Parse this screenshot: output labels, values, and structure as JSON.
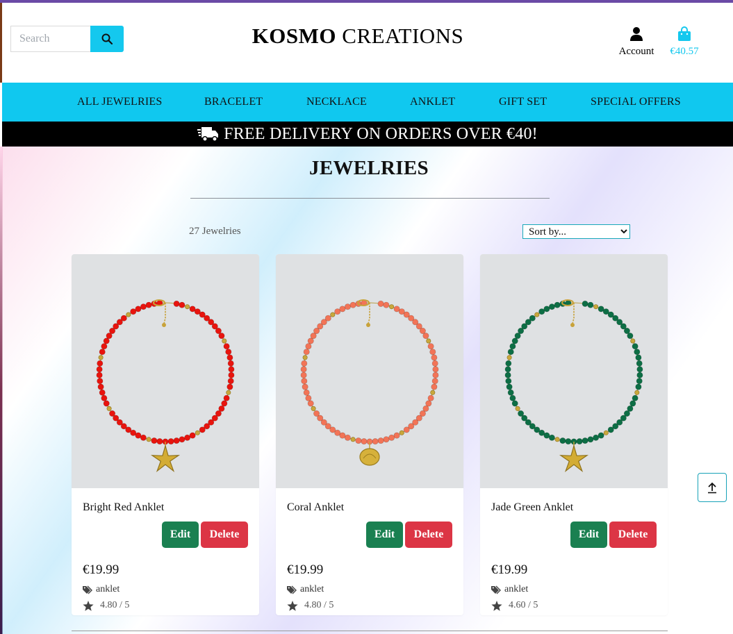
{
  "header": {
    "search_placeholder": "Search",
    "brand_bold": "KOSMO",
    "brand_rest": "CREATIONS",
    "account_label": "Account",
    "cart_total": "€40.57"
  },
  "nav": {
    "items": [
      "ALL JEWELRIES",
      "BRACELET",
      "NECKLACE",
      "ANKLET",
      "GIFT SET",
      "SPECIAL OFFERS"
    ]
  },
  "banner": {
    "text": "FREE DELIVERY ON ORDERS OVER €40!"
  },
  "main": {
    "title": "JEWELRIES",
    "count": "27 Jewelries",
    "sort_selected": "Sort by..."
  },
  "products": [
    {
      "name": "Bright Red Anklet",
      "price": "€19.99",
      "category": "anklet",
      "rating": "4.80 / 5",
      "edit_label": "Edit",
      "delete_label": "Delete",
      "bead_color": "#e8140e",
      "charm": "starfish"
    },
    {
      "name": "Coral Anklet",
      "price": "€19.99",
      "category": "anklet",
      "rating": "4.80 / 5",
      "edit_label": "Edit",
      "delete_label": "Delete",
      "bead_color": "#f27457",
      "charm": "shell"
    },
    {
      "name": "Jade Green Anklet",
      "price": "€19.99",
      "category": "anklet",
      "rating": "4.60 / 5",
      "edit_label": "Edit",
      "delete_label": "Delete",
      "bead_color": "#0d6e45",
      "charm": "starfish"
    }
  ],
  "colors": {
    "accent": "#10c8ef",
    "edit": "#1a8051",
    "delete": "#dc3545",
    "banner_bg": "#000000"
  }
}
